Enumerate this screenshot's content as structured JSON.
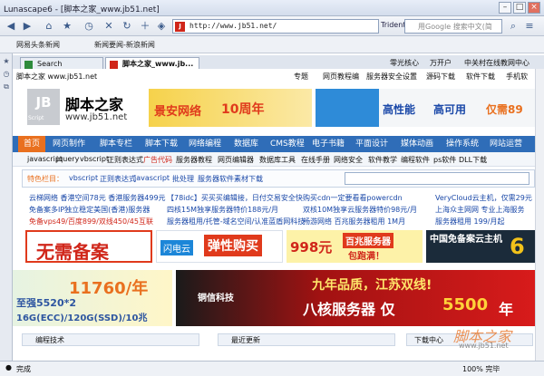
{
  "window": {
    "title": "Lunascape6 - [脚本之家_www.jb51.net]"
  },
  "toolbar": {
    "address": "http://www.jb51.net/",
    "engine": "Trident",
    "search_placeholder": "用Google 搜索中文(简"
  },
  "bookmarks": [
    "网易头条新闻",
    "新闻要闻-新浪新闻"
  ],
  "tabs": [
    {
      "label": "Search"
    },
    {
      "label": "脚本之家_www.jb..."
    }
  ],
  "links": {
    "top_right": [
      "零光核心",
      "万开户",
      "中关村在线教网中心"
    ]
  },
  "site": {
    "breadcrumb": "脚本之家 www.jb51.net",
    "top_links": [
      "专题",
      "网页教程编",
      "服务器安全设置",
      "源码下载",
      "软件下载",
      "手机软"
    ],
    "logo_name": "脚本之家",
    "logo_url": "www.jb51.net",
    "logo_badge": "Script",
    "banner_text": "景安网络",
    "banner_years": "10周年",
    "ad_text": [
      "高性能",
      "高可用",
      "仅需89"
    ],
    "nav": [
      "首页",
      "网页制作",
      "脚本专栏",
      "脚本下载",
      "网络编程",
      "数据库",
      "CMS教程",
      "电子书籍",
      "平面设计",
      "媒体动画",
      "操作系统",
      "网站运营"
    ],
    "subnav": [
      "javascript",
      "jquery",
      "vbscript",
      "正则表达式",
      "广告代码",
      "服务器教程",
      "网页编辑器",
      "数据库工具",
      "在线手册",
      "网络安全",
      "软件教学",
      "编程软件",
      "ps软件",
      "DLL下载"
    ],
    "feature_label": "特色栏目：",
    "feature_links": [
      "vbscript",
      "正则表达式",
      "javascript",
      "批处理",
      "服务器软件",
      "素材下载"
    ],
    "news_col1": [
      "云梯网络 香港空间78元 香港服务器499元",
      "免备案多IP独立稳定美国(香港)服务器",
      "免备vps49/百度899/双线450/45互联"
    ],
    "news_col2": [
      "【78idc】买买买编辑接，日付交易安全快",
      "四核15M独享服务器特价188元/月",
      "服务器租用/托管-域名空间/认准蓝盾网科技"
    ],
    "news_col3": [
      "购买cdn一定要看看powercdn",
      "双核10M独享云服务器特价98元/月",
      "畅游网络 百兆服务器租用 1M月"
    ],
    "news_col4": [
      "VeryCloud云主机，仅需29元",
      "上海众主网网 专业上海服务",
      "服务器租用 199/月起"
    ],
    "ads": [
      "无需备案",
      "闪电云",
      "弹性购买",
      "998元",
      "百兆服务器",
      "包跑满！",
      "中国免备案云主机",
      "6"
    ],
    "ad2": [
      "11760/年",
      "至强5520*2",
      "16G(ECC)/120G(SSD)/10兆",
      "铜信科技",
      "九年品质，江苏双线!",
      "八核服务器 仅",
      "5500",
      "年"
    ],
    "bottom": [
      "编程技术",
      "最近更新",
      "下载中心"
    ],
    "watermark": "脚本之家",
    "watermark_url": "www.jb51.net"
  },
  "status": {
    "text": "完成",
    "zoom": "100% 完毕"
  }
}
